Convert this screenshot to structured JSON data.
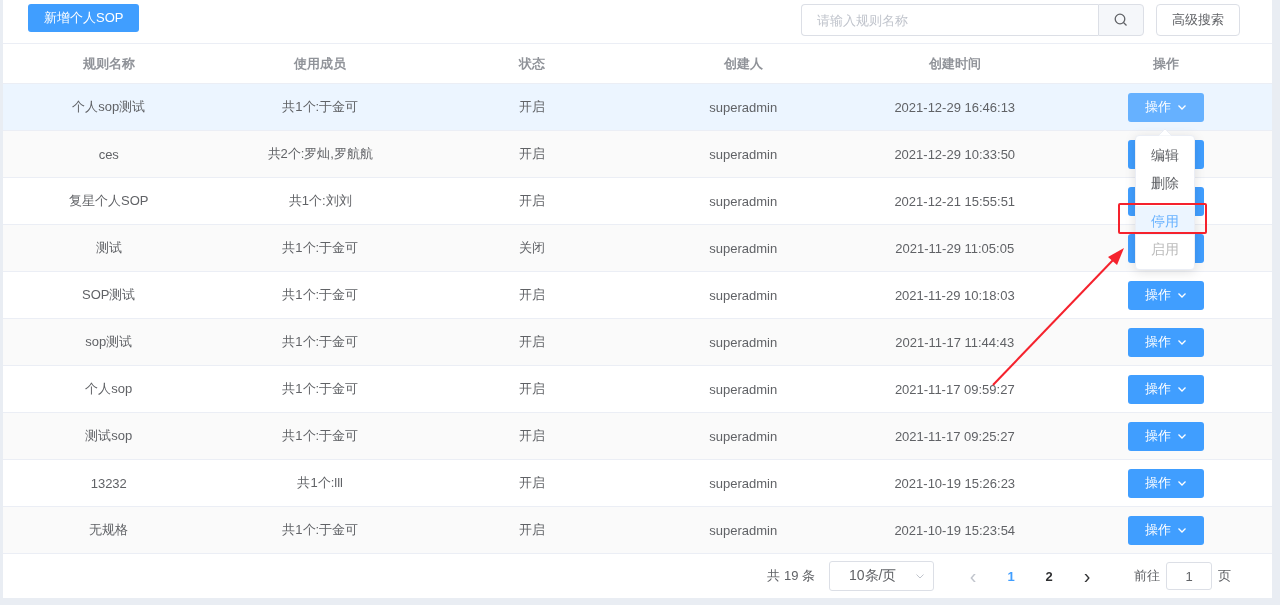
{
  "toolbar": {
    "add_button": "新增个人SOP",
    "search": {
      "placeholder": "请输入规则名称"
    },
    "advanced_button": "高级搜索"
  },
  "table": {
    "columns": [
      "规则名称",
      "使用成员",
      "状态",
      "创建人",
      "创建时间",
      "操作"
    ],
    "rows": [
      {
        "name": "个人sop测试",
        "members": "共1个:于金可",
        "status": "开启",
        "creator": "superadmin",
        "created": "2021-12-29 16:46:13",
        "action": "操作",
        "hovered": true
      },
      {
        "name": "ces",
        "members": "共2个:罗灿,罗航航",
        "status": "开启",
        "creator": "superadmin",
        "created": "2021-12-29 10:33:50",
        "hovered": false
      },
      {
        "name": "复星个人SOP",
        "members": "共1个:刘刘",
        "status": "开启",
        "creator": "superadmin",
        "created": "2021-12-21 15:55:51",
        "hovered": false
      },
      {
        "name": "测试",
        "members": "共1个:于金可",
        "status": "关闭",
        "creator": "superadmin",
        "created": "2021-11-29 11:05:05",
        "hovered": false
      },
      {
        "name": "SOP测试",
        "members": "共1个:于金可",
        "status": "开启",
        "creator": "superadmin",
        "created": "2021-11-29 10:18:03",
        "action": "操作",
        "hovered": false
      },
      {
        "name": "sop测试",
        "members": "共1个:于金可",
        "status": "开启",
        "creator": "superadmin",
        "created": "2021-11-17 11:44:43",
        "action": "操作",
        "hovered": false
      },
      {
        "name": "个人sop",
        "members": "共1个:于金可",
        "status": "开启",
        "creator": "superadmin",
        "created": "2021-11-17 09:59:27",
        "action": "操作",
        "hovered": false
      },
      {
        "name": "测试sop",
        "members": "共1个:于金可",
        "status": "开启",
        "creator": "superadmin",
        "created": "2021-11-17 09:25:27",
        "action": "操作",
        "hovered": false
      },
      {
        "name": "13232",
        "members": "共1个:lll",
        "status": "开启",
        "creator": "superadmin",
        "created": "2021-10-19 15:26:23",
        "action": "操作",
        "hovered": false
      },
      {
        "name": "无规格",
        "members": "共1个:于金可",
        "status": "开启",
        "creator": "superadmin",
        "created": "2021-10-19 15:23:54",
        "action": "操作",
        "hovered": false
      }
    ]
  },
  "action_menu": {
    "items": [
      {
        "label": "编辑",
        "hovered": false,
        "disabled": false,
        "divided": false,
        "annotated": false
      },
      {
        "label": "删除",
        "hovered": false,
        "disabled": false,
        "divided": false,
        "annotated": false
      },
      {
        "label": "停用",
        "hovered": true,
        "disabled": false,
        "divided": true,
        "annotated": true
      },
      {
        "label": "启用",
        "hovered": false,
        "disabled": true,
        "divided": false,
        "annotated": false
      }
    ]
  },
  "pagination": {
    "total": "共 19 条",
    "page_size": "10条/页",
    "prev": "‹",
    "pages": [
      {
        "label": "1",
        "selected": true
      },
      {
        "label": "2",
        "selected": false
      }
    ],
    "next": "›",
    "goto_label": "前往",
    "goto_value": "1",
    "goto_suffix": "页"
  }
}
